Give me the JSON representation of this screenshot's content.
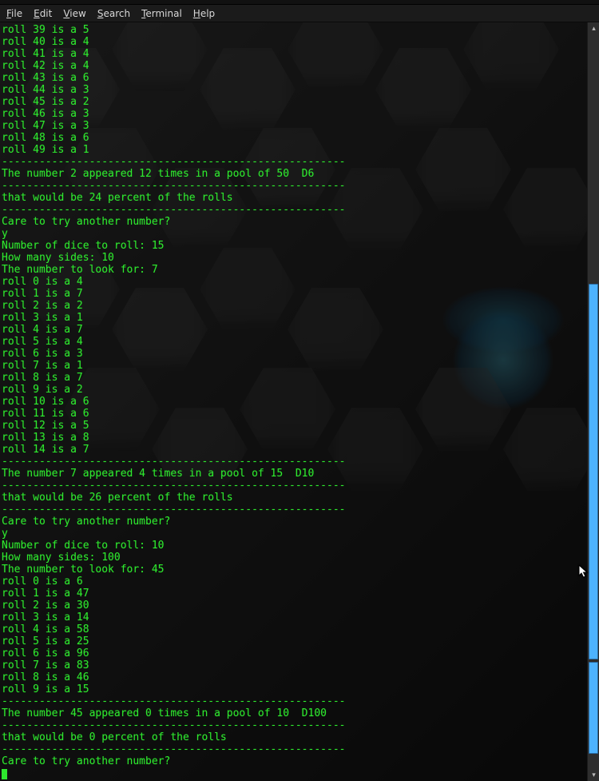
{
  "menu": {
    "items": [
      {
        "mn": "F",
        "rest": "ile"
      },
      {
        "mn": "E",
        "rest": "dit"
      },
      {
        "mn": "V",
        "rest": "iew"
      },
      {
        "mn": "S",
        "rest": "earch"
      },
      {
        "mn": "T",
        "rest": "erminal"
      },
      {
        "mn": "H",
        "rest": "elp"
      }
    ]
  },
  "separator": "-------------------------------------------------------",
  "terminal": {
    "block1_rolls": [
      "roll 39 is a 5",
      "roll 40 is a 4",
      "roll 41 is a 4",
      "roll 42 is a 4",
      "roll 43 is a 6",
      "roll 44 is a 3",
      "roll 45 is a 2",
      "roll 46 is a 3",
      "roll 47 is a 3",
      "roll 48 is a 6",
      "roll 49 is a 1"
    ],
    "block1_summary1": "The number 2 appeared 12 times in a pool of 50  D6",
    "block1_summary2": "that would be 24 percent of the rolls",
    "care": "Care to try another number?",
    "yes": "y",
    "prompt_dice": "Number of dice to roll: ",
    "prompt_sides": "How many sides: ",
    "prompt_lookfor": "The number to look for: ",
    "block2_inputs": {
      "dice": "15",
      "sides": "10",
      "look": "7"
    },
    "block2_rolls": [
      "roll 0 is a 4",
      "roll 1 is a 7",
      "roll 2 is a 2",
      "roll 3 is a 1",
      "roll 4 is a 7",
      "roll 5 is a 4",
      "roll 6 is a 3",
      "roll 7 is a 1",
      "roll 8 is a 7",
      "roll 9 is a 2",
      "roll 10 is a 6",
      "roll 11 is a 6",
      "roll 12 is a 5",
      "roll 13 is a 8",
      "roll 14 is a 7"
    ],
    "block2_summary1": "The number 7 appeared 4 times in a pool of 15  D10",
    "block2_summary2": "that would be 26 percent of the rolls",
    "block3_inputs": {
      "dice": "10",
      "sides": "100",
      "look": "45"
    },
    "block3_rolls": [
      "roll 0 is a 6",
      "roll 1 is a 47",
      "roll 2 is a 30",
      "roll 3 is a 14",
      "roll 4 is a 58",
      "roll 5 is a 25",
      "roll 6 is a 96",
      "roll 7 is a 83",
      "roll 8 is a 46",
      "roll 9 is a 15"
    ],
    "block3_summary1": "The number 45 appeared 0 times in a pool of 10  D100",
    "block3_summary2": "that would be 0 percent of the rolls"
  }
}
